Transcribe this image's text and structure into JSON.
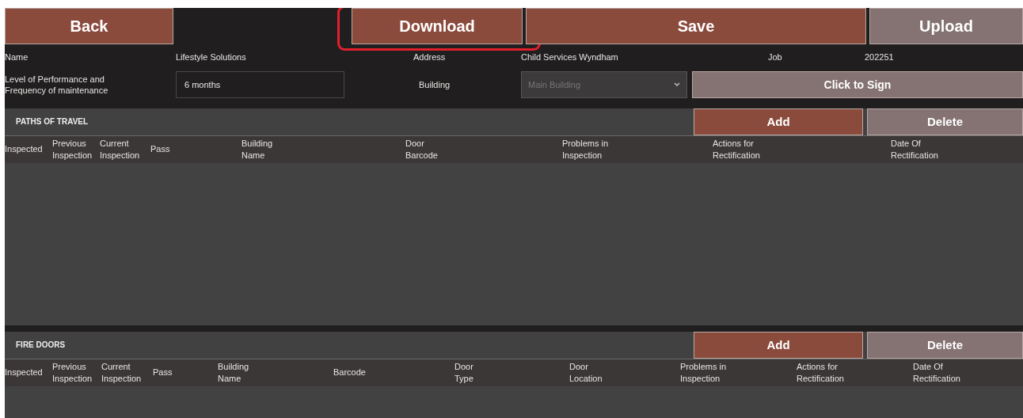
{
  "toolbar": [
    {
      "label": "Back",
      "disabled": false,
      "highlighted": false
    },
    {
      "label": "Download",
      "disabled": false,
      "highlighted": true
    },
    {
      "label": "Save",
      "disabled": false,
      "highlighted": false
    },
    {
      "label": "Upload",
      "disabled": true,
      "highlighted": false
    }
  ],
  "info": {
    "name_label": "Name",
    "name_value": "Lifestyle Solutions",
    "address_label": "Address",
    "address_value": "Child Services  Wyndham",
    "job_label": "Job",
    "job_value": "202251",
    "level_label": "Level of Performance and\nFrequency of maintenance",
    "level_value": "6 months",
    "building_label": "Building",
    "building_placeholder": "Main Building",
    "sign_button": {
      "label": "Click to Sign",
      "disabled": true
    }
  },
  "sections": [
    {
      "title": "PATHS OF TRAVEL",
      "add": {
        "label": "Add",
        "disabled": false
      },
      "delete": {
        "label": "Delete",
        "disabled": true
      },
      "columns": [
        "Inspected",
        "Previous\nInspection",
        "Current\nInspection",
        "Pass",
        "Building\nName",
        "Door\nBarcode",
        "Problems in\nInspection",
        "Actions for\nRectification",
        "Date Of\nRectification"
      ]
    },
    {
      "title": "FIRE DOORS",
      "add": {
        "label": "Add",
        "disabled": false
      },
      "delete": {
        "label": "Delete",
        "disabled": true
      },
      "columns": [
        "Inspected",
        "Previous\nInspection",
        "Current\nInspection",
        "Pass",
        "Building\nName",
        "Barcode",
        "Door\nType",
        "Door\nLocation",
        "Problems in\nInspection",
        "Actions for\nRectification",
        "Date Of\nRectification"
      ]
    }
  ]
}
